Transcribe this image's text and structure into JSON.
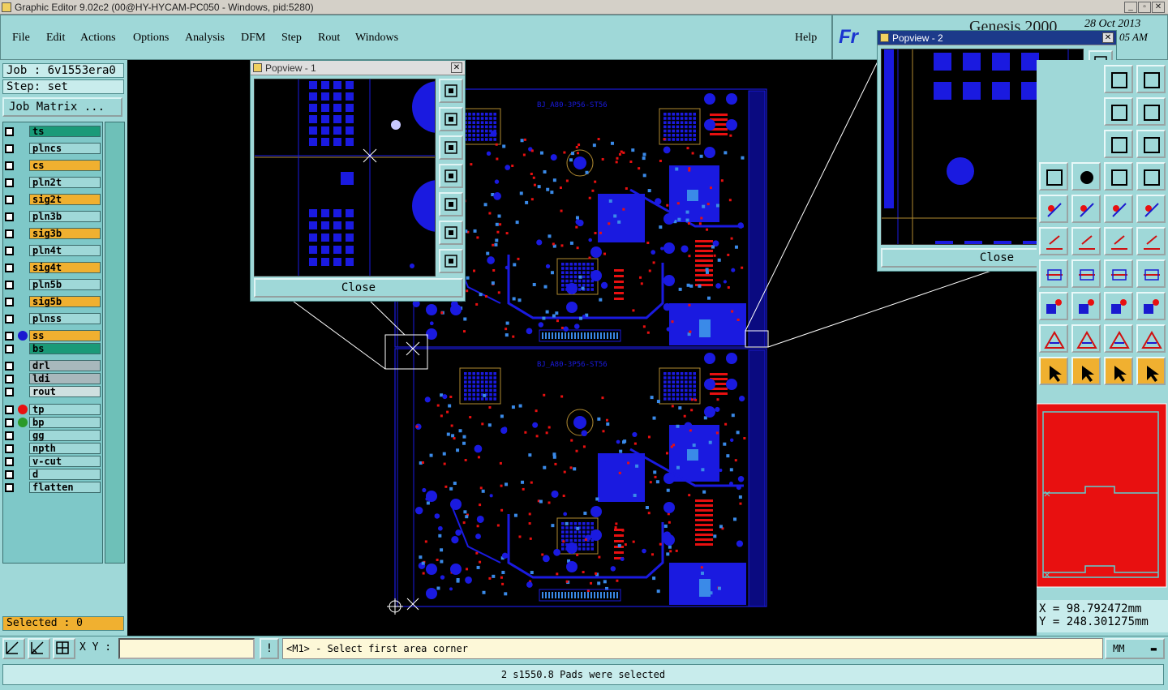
{
  "window": {
    "title": "Graphic Editor 9.02c2 (00@HY-HYCAM-PC050 - Windows, pid:5280)"
  },
  "menu": {
    "items": [
      "File",
      "Edit",
      "Actions",
      "Options",
      "Analysis",
      "DFM",
      "Step",
      "Rout",
      "Windows"
    ],
    "help": "Help"
  },
  "header": {
    "brand": "Genesis 2000",
    "logo": "Fr",
    "date": "28 Oct 2013",
    "time": "05 AM"
  },
  "job": {
    "job_label": "Job : 6v1553era0",
    "step_label": "Step: set",
    "matrix_button": "Job Matrix ..."
  },
  "layers": [
    {
      "name": "ts",
      "style": "side-g",
      "dot": ""
    },
    {
      "name": "plncs",
      "style": "side-c",
      "dot": ""
    },
    {
      "name": "cs",
      "style": "side-y",
      "dot": ""
    },
    {
      "name": "pln2t",
      "style": "side-c",
      "dot": ""
    },
    {
      "name": "sig2t",
      "style": "side-y",
      "dot": ""
    },
    {
      "name": "pln3b",
      "style": "side-c",
      "dot": ""
    },
    {
      "name": "sig3b",
      "style": "side-y",
      "dot": ""
    },
    {
      "name": "pln4t",
      "style": "side-c",
      "dot": ""
    },
    {
      "name": "sig4t",
      "style": "side-y",
      "dot": ""
    },
    {
      "name": "pln5b",
      "style": "side-c",
      "dot": ""
    },
    {
      "name": "sig5b",
      "style": "side-y",
      "dot": ""
    },
    {
      "name": "plnss",
      "style": "side-c",
      "dot": ""
    },
    {
      "name": "ss",
      "style": "side-y",
      "dot": "#1a1ad0"
    },
    {
      "name": "bs",
      "style": "side-g",
      "dot": ""
    },
    {
      "name": "drl",
      "style": "side-gray",
      "dot": ""
    },
    {
      "name": "ldi",
      "style": "side-gray",
      "dot": ""
    },
    {
      "name": "rout",
      "style": "side-lg",
      "dot": ""
    },
    {
      "name": "tp",
      "style": "side-c",
      "dot": "#e81010"
    },
    {
      "name": "bp",
      "style": "side-c",
      "dot": "#2a9a2a"
    },
    {
      "name": "gg",
      "style": "side-c",
      "dot": ""
    },
    {
      "name": "npth",
      "style": "side-c",
      "dot": ""
    },
    {
      "name": "v-cut",
      "style": "side-c",
      "dot": ""
    },
    {
      "name": "d",
      "style": "side-c",
      "dot": ""
    },
    {
      "name": "flatten",
      "style": "side-c",
      "dot": ""
    }
  ],
  "selection": {
    "label": "Selected : 0"
  },
  "popview1": {
    "title": "Popview - 1",
    "close": "Close"
  },
  "popview2": {
    "title": "Popview - 2",
    "close": "Close"
  },
  "pcb": {
    "silk_text": "BJ_A80-3P56-ST56"
  },
  "coords": {
    "x": "X = 98.792472mm",
    "y": "Y = 248.301275mm"
  },
  "bottom": {
    "xy_label": "X Y :",
    "xy_value": "",
    "bang": "!",
    "prompt": "<M1> - Select first area corner",
    "units": "MM"
  },
  "status": {
    "message": "2 s1550.8 Pads were selected"
  },
  "colors": {
    "accent": "#9fd8d8",
    "highlight": "#f0b030",
    "board_copper": "#1a1ae0",
    "pads": "#e81010"
  }
}
